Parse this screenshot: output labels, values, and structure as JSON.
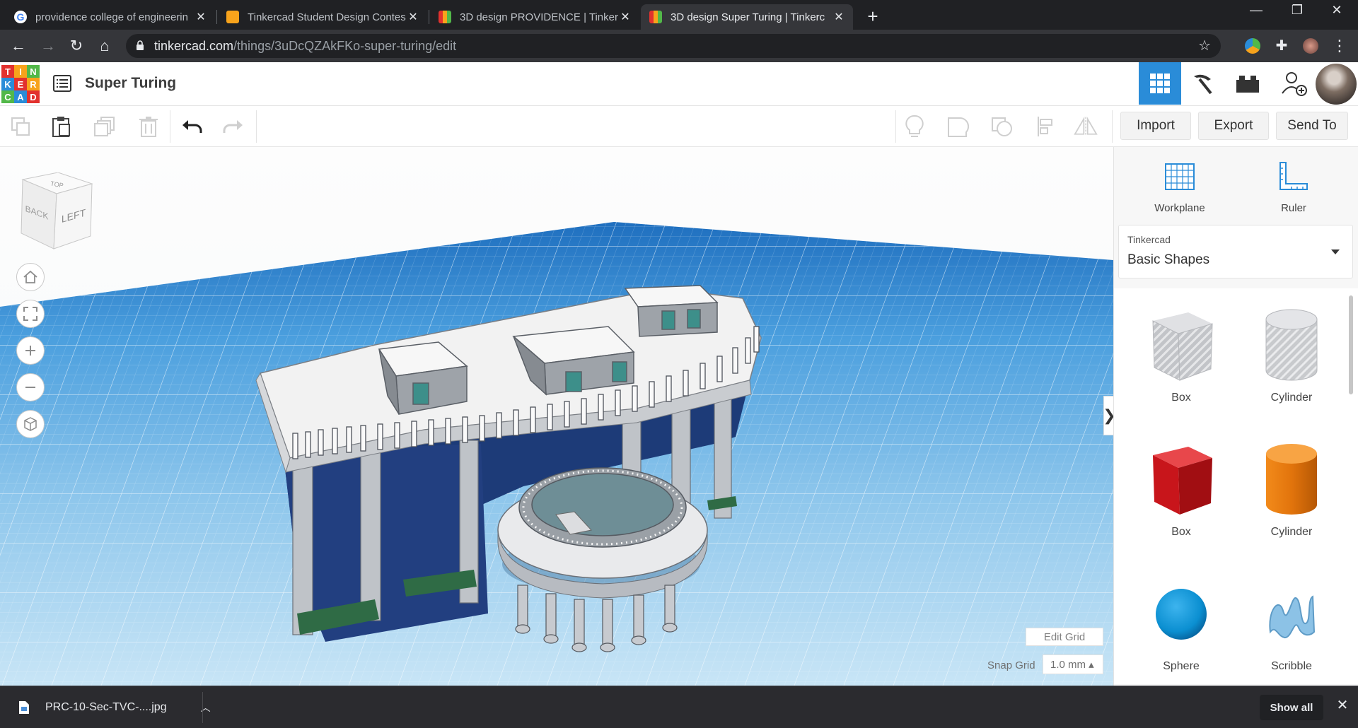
{
  "browser": {
    "tabs": [
      {
        "title": "providence college of engineerin",
        "active": false
      },
      {
        "title": "Tinkercad Student Design Contes",
        "active": false
      },
      {
        "title": "3D design PROVIDENCE | Tinkerc",
        "active": false
      },
      {
        "title": "3D design Super Turing | Tinkerc",
        "active": true
      }
    ],
    "new_tab": "+",
    "window_controls": {
      "minimize": "—",
      "maximize": "❐",
      "close": "✕"
    },
    "url_host": "tinkercad.com",
    "url_path": "/things/3uDcQZAkFKo-super-turing/edit"
  },
  "app": {
    "logo_letters": [
      "T",
      "I",
      "N",
      "K",
      "E",
      "R",
      "C",
      "A",
      "D"
    ],
    "logo_colors": [
      "#e2312e",
      "#f7a31c",
      "#52b849",
      "#2a8cd8",
      "#e2312e",
      "#f7a31c",
      "#52b849",
      "#2a8cd8",
      "#e2312e"
    ],
    "design_name": "Super Turing",
    "accent": "#2a8cd8"
  },
  "toolbar": {
    "import_label": "Import",
    "export_label": "Export",
    "sendto_label": "Send To"
  },
  "viewcube": {
    "top": "TOP",
    "front": "LEFT",
    "side": "BACK"
  },
  "workspace": {
    "edit_grid_label": "Edit Grid",
    "snap_grid_label": "Snap Grid",
    "snap_grid_value": "1.0 mm ▴",
    "collapse_glyph": "❯"
  },
  "panel": {
    "workplane_label": "Workplane",
    "ruler_label": "Ruler",
    "library_owner": "Tinkercad",
    "library_name": "Basic Shapes",
    "shapes": [
      {
        "label": "Box",
        "kind": "hole-box"
      },
      {
        "label": "Cylinder",
        "kind": "hole-cylinder"
      },
      {
        "label": "Box",
        "kind": "box"
      },
      {
        "label": "Cylinder",
        "kind": "cylinder"
      },
      {
        "label": "Sphere",
        "kind": "sphere"
      },
      {
        "label": "Scribble",
        "kind": "scribble"
      }
    ]
  },
  "downloads": {
    "file_name": "PRC-10-Sec-TVC-....jpg",
    "show_all_label": "Show all"
  }
}
